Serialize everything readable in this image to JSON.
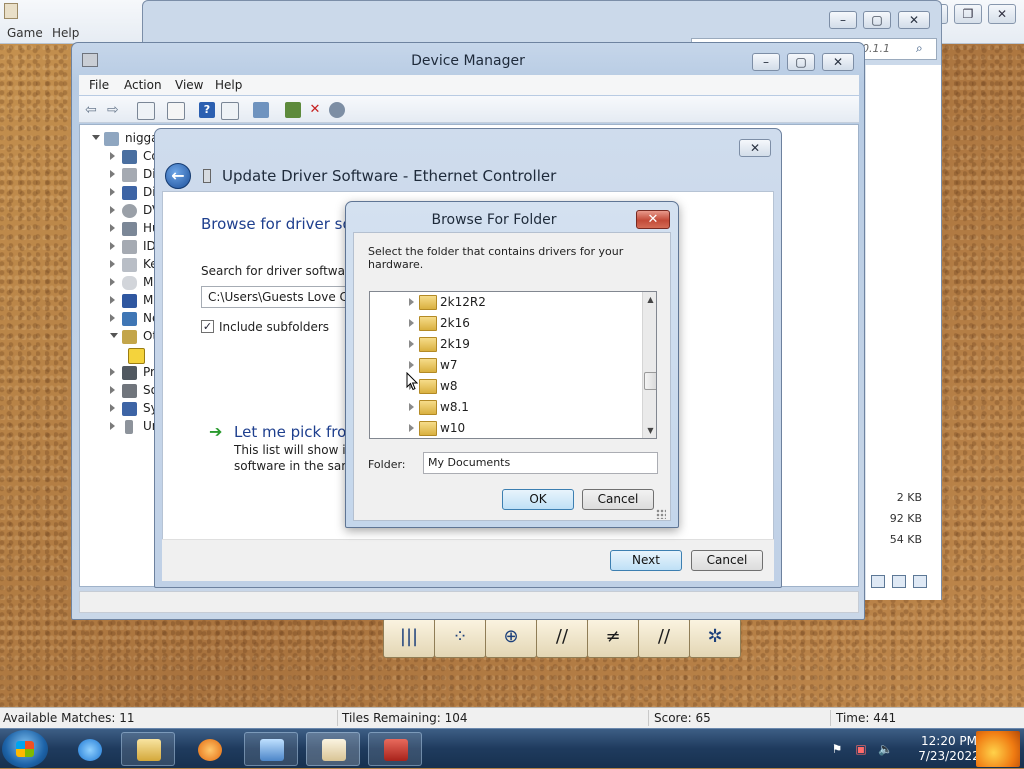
{
  "game": {
    "menu": [
      "Game",
      "Help"
    ],
    "status": {
      "matches": "Available Matches: 11",
      "tiles": "Tiles Remaining: 104",
      "score": "Score: 65",
      "time": "Time: 441"
    }
  },
  "explorer": {
    "search_text": "0.1.1",
    "sizes": [
      "2 KB",
      "92 KB",
      "54 KB"
    ]
  },
  "device_manager": {
    "title": "Device Manager",
    "menu": [
      "File",
      "Action",
      "View",
      "Help"
    ],
    "tree": {
      "root": "nigga",
      "items": [
        "Co",
        "Di",
        "Di",
        "DV",
        "Hu",
        "ID",
        "Ke",
        "Mi",
        "Mo",
        "Ne",
        "Ot",
        "",
        "Pr",
        "So",
        "Sy",
        "Un"
      ]
    }
  },
  "update_driver": {
    "title": "Update Driver Software - Ethernet Controller",
    "heading": "Browse for driver sof",
    "search_label": "Search for driver software in",
    "path": "C:\\Users\\Guests Love Cock",
    "include_subfolders": "Include subfolders",
    "pick_heading": "Let me pick from",
    "pick_desc_1": "This list will show inst",
    "pick_desc_2": "software in the same",
    "next": "Next",
    "cancel": "Cancel"
  },
  "browse_folder": {
    "title": "Browse For Folder",
    "description": "Select the folder that contains drivers for your hardware.",
    "folders": [
      "2k12R2",
      "2k16",
      "2k19",
      "w7",
      "w8",
      "w8.1",
      "w10"
    ],
    "folder_label": "Folder:",
    "folder_value": "My Documents",
    "ok": "OK",
    "cancel": "Cancel"
  },
  "taskbar": {
    "time": "12:20 PM",
    "date": "7/23/2022"
  },
  "colors": {
    "accent": "#1e3f8e",
    "link_green": "#2a9a2e"
  }
}
